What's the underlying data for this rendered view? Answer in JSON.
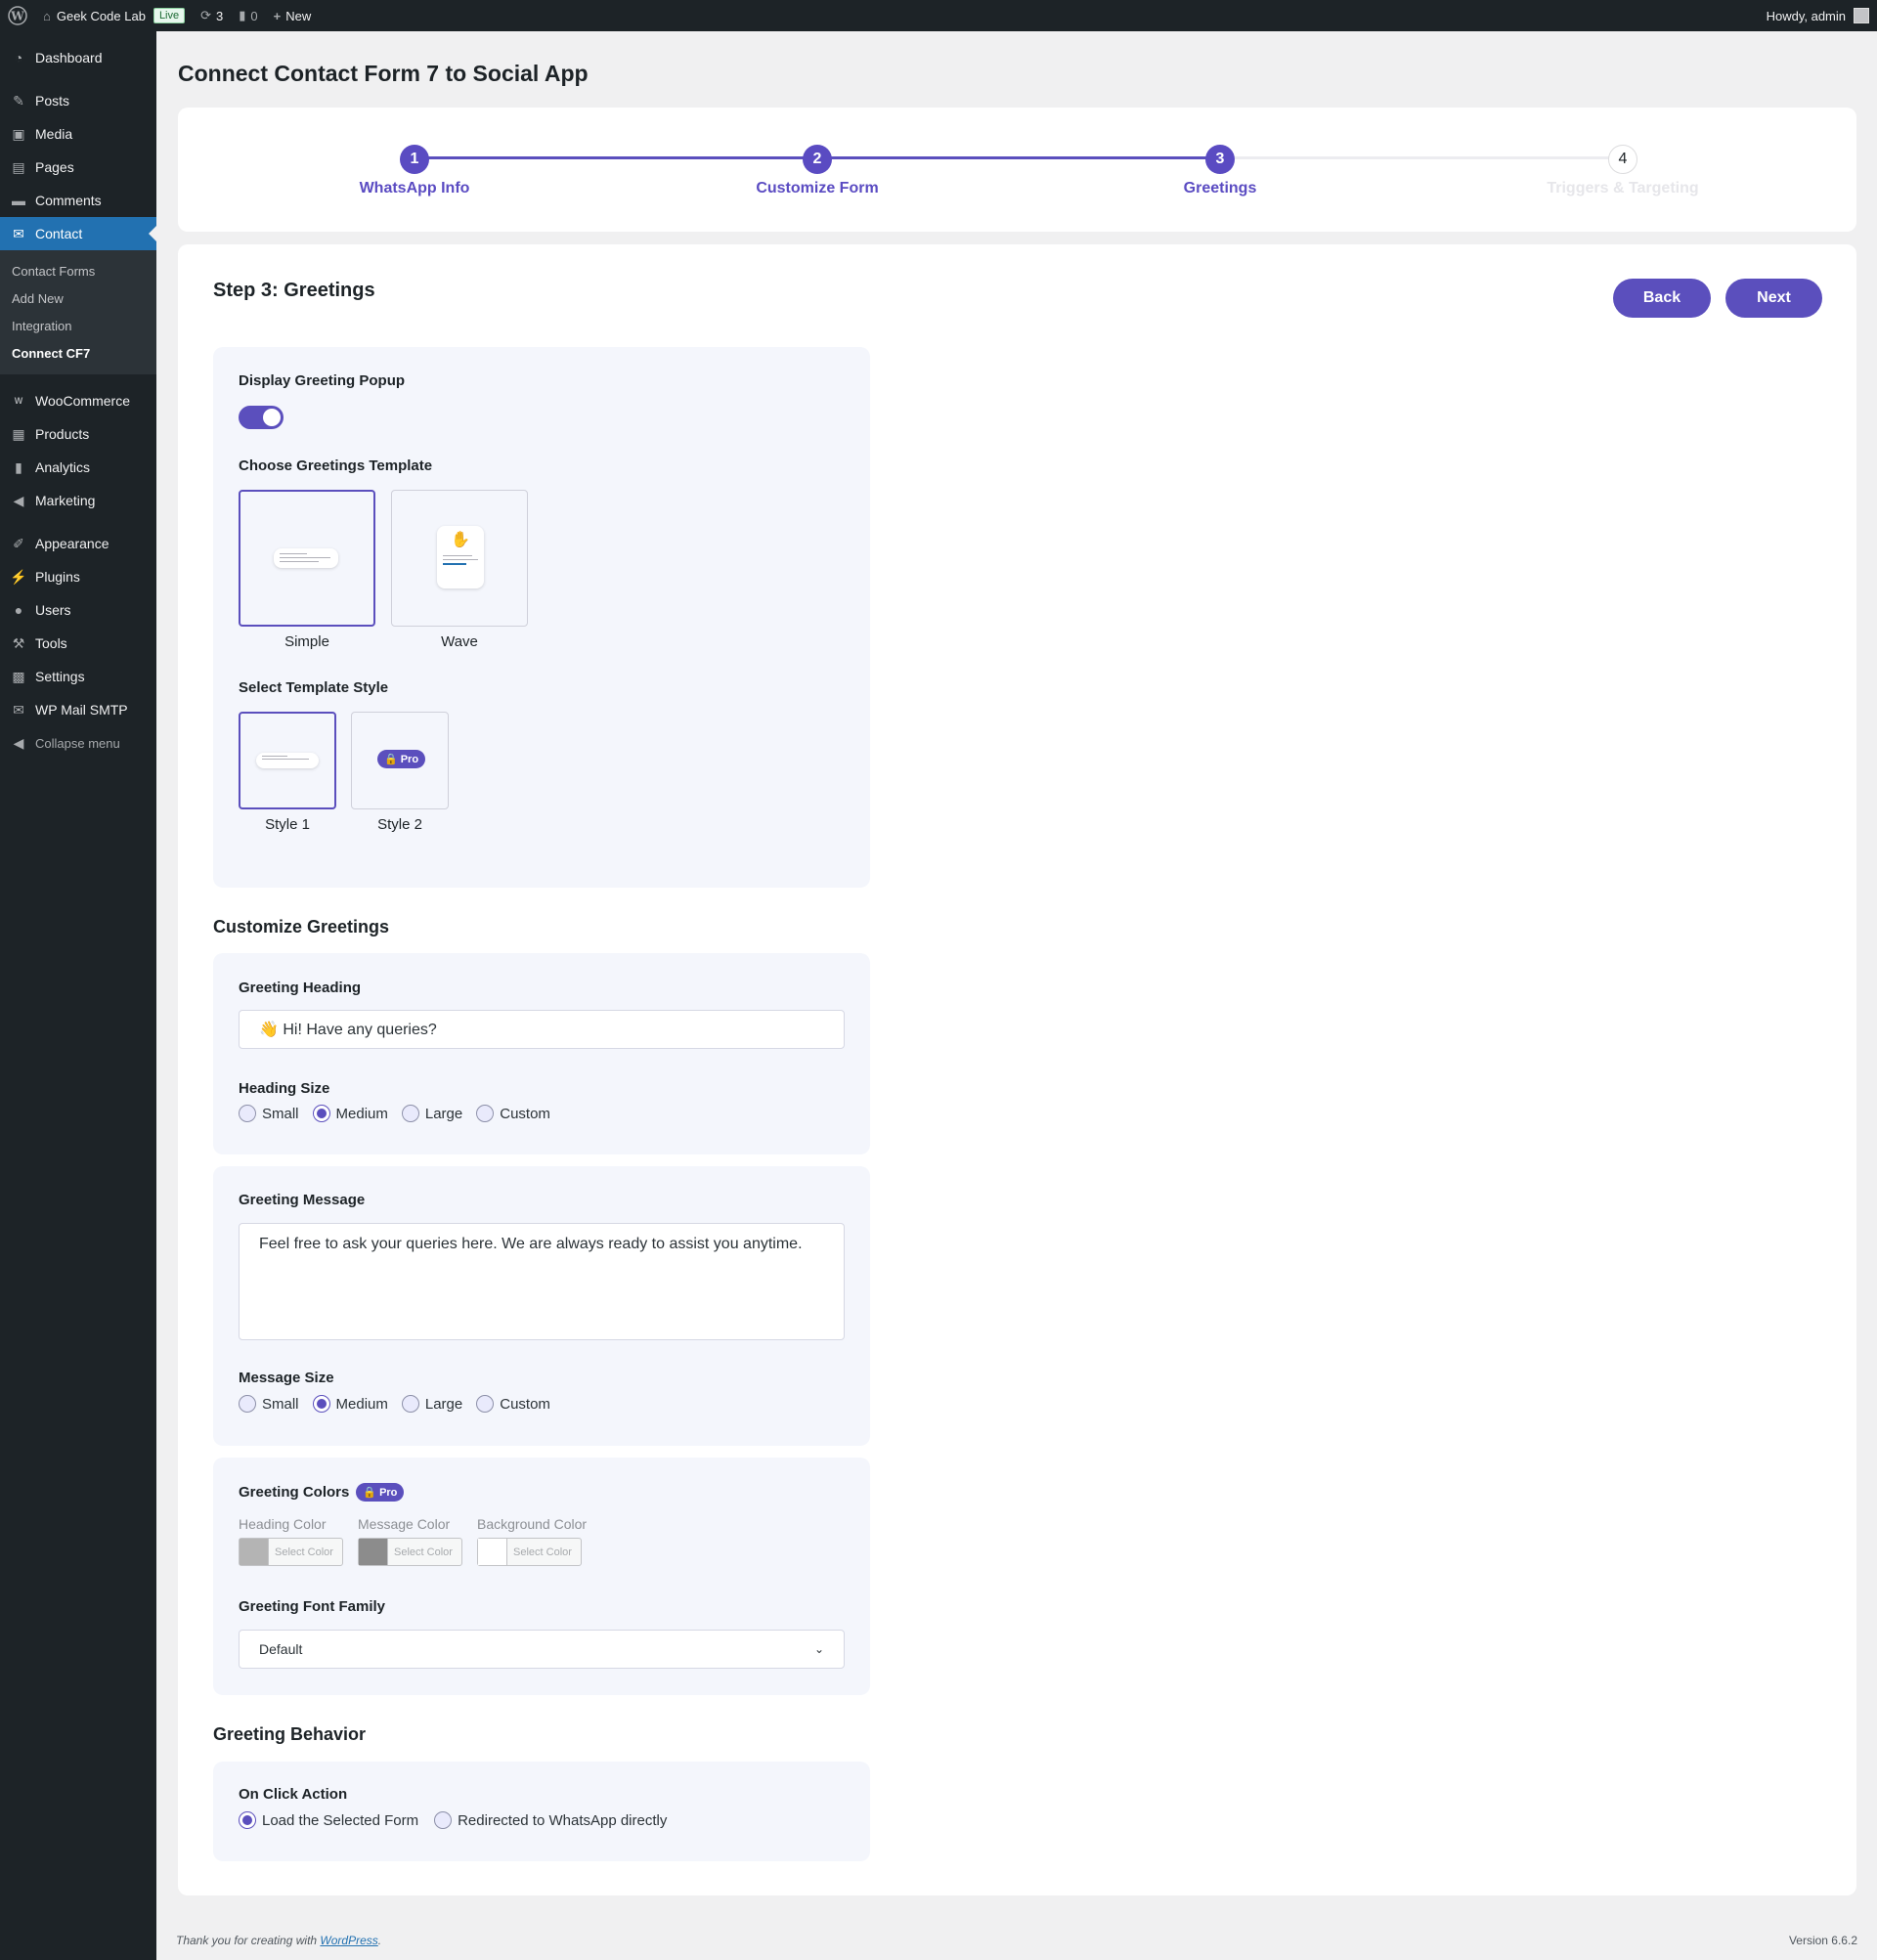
{
  "adminbar": {
    "site_name": "Geek Code Lab",
    "live_badge": "Live",
    "updates_count": "3",
    "comments_count": "0",
    "new_label": "New",
    "howdy": "Howdy, admin"
  },
  "sidebar": {
    "dashboard": "Dashboard",
    "posts": "Posts",
    "media": "Media",
    "pages": "Pages",
    "comments": "Comments",
    "contact": "Contact",
    "contact_sub": [
      "Contact Forms",
      "Add New",
      "Integration",
      "Connect CF7"
    ],
    "woocommerce": "WooCommerce",
    "products": "Products",
    "analytics": "Analytics",
    "marketing": "Marketing",
    "appearance": "Appearance",
    "plugins": "Plugins",
    "users": "Users",
    "tools": "Tools",
    "settings": "Settings",
    "wp_mail_smtp": "WP Mail SMTP",
    "collapse": "Collapse menu"
  },
  "page": {
    "title": "Connect Contact Form 7 to Social App"
  },
  "stepper": {
    "steps": [
      {
        "number": "1",
        "label": "WhatsApp Info"
      },
      {
        "number": "2",
        "label": "Customize Form"
      },
      {
        "number": "3",
        "label": "Greetings"
      },
      {
        "number": "4",
        "label": "Triggers & Targeting"
      }
    ],
    "current": 3
  },
  "step_content": {
    "heading": "Step 3: Greetings",
    "back_label": "Back",
    "next_label": "Next"
  },
  "display_popup": {
    "label": "Display Greeting Popup",
    "enabled": true
  },
  "templates": {
    "label": "Choose Greetings Template",
    "options": [
      "Simple",
      "Wave"
    ],
    "selected": "Simple"
  },
  "template_style": {
    "label": "Select Template Style",
    "options": [
      "Style 1",
      "Style 2"
    ],
    "selected": "Style 1",
    "pro_badge": "Pro"
  },
  "customize": {
    "heading": "Customize Greetings",
    "greeting_heading_label": "Greeting Heading",
    "greeting_heading_value": "👋 Hi! Have any queries?",
    "heading_size_label": "Heading Size",
    "size_options": [
      "Small",
      "Medium",
      "Large",
      "Custom"
    ],
    "heading_size_selected": "Medium",
    "greeting_message_label": "Greeting Message",
    "greeting_message_value": "Feel free to ask your queries here. We are always ready to assist you anytime.",
    "message_size_label": "Message Size",
    "message_size_selected": "Medium"
  },
  "colors": {
    "label": "Greeting Colors",
    "pro_badge": "Pro",
    "items": [
      {
        "label": "Heading Color",
        "button": "Select Color",
        "swatch": "#b4b4b4"
      },
      {
        "label": "Message Color",
        "button": "Select Color",
        "swatch": "#8c8c8c"
      },
      {
        "label": "Background Color",
        "button": "Select Color",
        "swatch": "#ffffff"
      }
    ],
    "font_family_label": "Greeting Font Family",
    "font_family_value": "Default"
  },
  "behavior": {
    "heading": "Greeting Behavior",
    "on_click_label": "On Click Action",
    "options": [
      "Load the Selected Form",
      "Redirected to WhatsApp directly"
    ],
    "selected": "Load the Selected Form"
  },
  "footer": {
    "thanks_prefix": "Thank you for creating with ",
    "wordpress_link": "WordPress",
    "thanks_suffix": ".",
    "version": "Version 6.6.2"
  },
  "accent_color": "#5b4fbd"
}
